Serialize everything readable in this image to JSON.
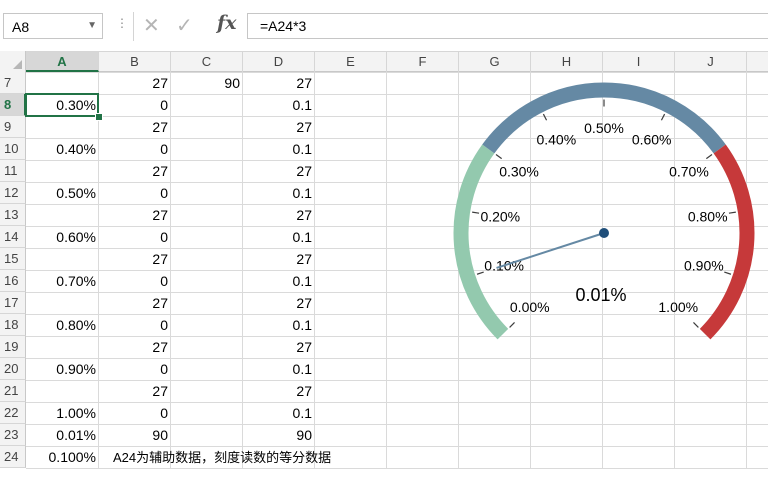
{
  "formula_bar": {
    "name_box": "A8",
    "formula": "=A24*3",
    "fx_label": "fx"
  },
  "columns": [
    "A",
    "B",
    "C",
    "D",
    "E",
    "F",
    "G",
    "H",
    "I",
    "J"
  ],
  "selected_column": "A",
  "rows": [
    {
      "n": "7",
      "a": "",
      "b": "27",
      "c": "90",
      "d": "27"
    },
    {
      "n": "8",
      "a": "0.30%",
      "b": "0",
      "c": "",
      "d": "0.1"
    },
    {
      "n": "9",
      "a": "",
      "b": "27",
      "c": "",
      "d": "27"
    },
    {
      "n": "10",
      "a": "0.40%",
      "b": "0",
      "c": "",
      "d": "0.1"
    },
    {
      "n": "11",
      "a": "",
      "b": "27",
      "c": "",
      "d": "27"
    },
    {
      "n": "12",
      "a": "0.50%",
      "b": "0",
      "c": "",
      "d": "0.1"
    },
    {
      "n": "13",
      "a": "",
      "b": "27",
      "c": "",
      "d": "27"
    },
    {
      "n": "14",
      "a": "0.60%",
      "b": "0",
      "c": "",
      "d": "0.1"
    },
    {
      "n": "15",
      "a": "",
      "b": "27",
      "c": "",
      "d": "27"
    },
    {
      "n": "16",
      "a": "0.70%",
      "b": "0",
      "c": "",
      "d": "0.1"
    },
    {
      "n": "17",
      "a": "",
      "b": "27",
      "c": "",
      "d": "27"
    },
    {
      "n": "18",
      "a": "0.80%",
      "b": "0",
      "c": "",
      "d": "0.1"
    },
    {
      "n": "19",
      "a": "",
      "b": "27",
      "c": "",
      "d": "27"
    },
    {
      "n": "20",
      "a": "0.90%",
      "b": "0",
      "c": "",
      "d": "0.1"
    },
    {
      "n": "21",
      "a": "",
      "b": "27",
      "c": "",
      "d": "27"
    },
    {
      "n": "22",
      "a": "1.00%",
      "b": "0",
      "c": "",
      "d": "0.1"
    },
    {
      "n": "23",
      "a": "0.01%",
      "b": "90",
      "c": "",
      "d": "90"
    },
    {
      "n": "24",
      "a": "0.100%",
      "b": "",
      "c": "",
      "d": ""
    }
  ],
  "selected_row": "8",
  "note": "A24为辅助数据，刻度读数的等分数据",
  "gauge": {
    "labels": [
      "0.00%",
      "0.10%",
      "0.20%",
      "0.30%",
      "0.40%",
      "0.50%",
      "0.60%",
      "0.70%",
      "0.80%",
      "0.90%",
      "1.00%"
    ],
    "value": 0.01,
    "value_label": "0.01%",
    "min": 0,
    "max": 1,
    "bands": [
      {
        "from": 0.0,
        "to": 0.3,
        "color": "#93c9ae"
      },
      {
        "from": 0.3,
        "to": 0.7,
        "color": "#6589a4"
      },
      {
        "from": 0.7,
        "to": 1.0,
        "color": "#c6393a"
      }
    ],
    "needle_color": "#6589a4",
    "hub_color": "#1f4e79"
  },
  "colors": {
    "accent": "#217346"
  }
}
